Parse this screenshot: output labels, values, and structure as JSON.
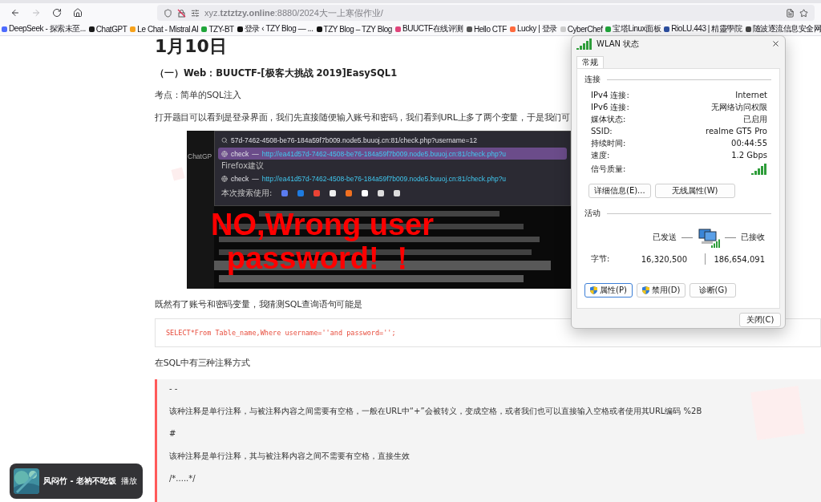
{
  "browser": {
    "nav_buttons": [
      {
        "kind": "back",
        "disabled": false
      },
      {
        "kind": "forward",
        "disabled": true
      },
      {
        "kind": "reload",
        "disabled": false
      },
      {
        "kind": "home",
        "disabled": false
      }
    ],
    "url": "xyz.**tztztzy.online**:8880/2024大一上寒假作业/",
    "bookmarks": [
      {
        "label": "DeepSeek - 探索未至...",
        "color": "#4d6bfe"
      },
      {
        "label": "ChatGPT",
        "color": "#1a1a1a"
      },
      {
        "label": "Le Chat - Mistral AI",
        "color": "#f7a21b"
      },
      {
        "label": "TZY-BT",
        "color": "#20a53a"
      },
      {
        "label": "登录 ‹ TZY Blog — ...",
        "color": "#111111"
      },
      {
        "label": "TZY Blog – TZY Blog",
        "color": "#111111"
      },
      {
        "label": "BUUCTF在线评测",
        "color": "#e0457b"
      },
      {
        "label": "Hello CTF",
        "color": "#555555"
      },
      {
        "label": "Lucky | 登录",
        "color": "#ff6a3d"
      },
      {
        "label": "CyberChef",
        "color": "#cccccc"
      },
      {
        "label": "宝塔Linux面板",
        "color": "#20a53a"
      },
      {
        "label": "RioLU.443 | 精靈學院",
        "color": "#2d4fa0"
      },
      {
        "label": "随波逐流信息安全网",
        "color": "#444444"
      }
    ]
  },
  "article": {
    "blocks": [
      {
        "kind": "title",
        "text": "1月10日"
      },
      {
        "kind": "heading",
        "text": "（一）Web：BUUCTF-[极客大挑战 2019]EasySQL1"
      },
      {
        "kind": "paragraph",
        "text": "考点：简单的SQL注入"
      },
      {
        "kind": "paragraph",
        "text": "打开题目可以看到是登录界面，我们先直接随便输入账号和密码，我们看到URL上多了两个变量，于是我们可"
      },
      {
        "kind": "screenshot",
        "side_label": "ChatGP",
        "search_text": "57d-7462-4508-be76-184a59f7b009.node5.buuoj.cn:81/check.php?username=12",
        "items": [
          {
            "kind": "row",
            "title": "check",
            "separator": "—",
            "url": "http://ea41d57d-7462-4508-be76-184a59f7b009.node5.buuoj.cn:81/check.php?u",
            "selected": true
          },
          {
            "kind": "label",
            "text": "Firefox建议"
          },
          {
            "kind": "row",
            "title": "check",
            "separator": "—",
            "url": "http://ea41d57d-7462-4508-be76-184a59f7b009.node5.buuoj.cn:81/check.php?u",
            "selected": false
          }
        ],
        "engines_label": "本次搜索使用:",
        "overlay_lines": [
          "NO,Wrong user",
          "password! ！"
        ]
      },
      {
        "kind": "paragraph",
        "text": "既然有了账号和密码变量，我猜测SQL查询语句可能是"
      },
      {
        "kind": "code",
        "text": "SELECT*From Table_name,Where username=''and password='';"
      },
      {
        "kind": "paragraph",
        "text": "在SQL中有三种注释方式"
      },
      {
        "kind": "quote",
        "lines": [
          "- -",
          "该种注释是单行注释，与被注释内容之间需要有空格，一般在URL中“+”会被转义，变成空格，或者我们也可以直接输入空格或者使用其URL编码 %2B",
          "#",
          "该种注释是单行注释，其与被注释内容之间不需要有空格，直接生效",
          "/*.....*/"
        ]
      }
    ]
  },
  "dialog": {
    "title": "WLAN 状态",
    "tabs": [
      {
        "label": "常规",
        "selected": true
      }
    ],
    "connection_heading": "连接",
    "rows": [
      {
        "kind": "text",
        "label": "IPv4 连接:",
        "value": "Internet"
      },
      {
        "kind": "text",
        "label": "IPv6 连接:",
        "value": "无网络访问权限"
      },
      {
        "kind": "text",
        "label": "媒体状态:",
        "value": "已启用"
      },
      {
        "kind": "text",
        "label": "SSID:",
        "value": "realme GT5 Pro"
      },
      {
        "kind": "text",
        "label": "持续时间:",
        "value": "00:44:55"
      },
      {
        "kind": "text",
        "label": "速度:",
        "value": "1.2 Gbps"
      },
      {
        "kind": "signal",
        "label": "信号质量:"
      }
    ],
    "detail_buttons": [
      "详细信息(E)...",
      "无线属性(W)"
    ],
    "activity_heading": "活动",
    "sent_label": "已发送",
    "received_label": "已接收",
    "bytes_label": "字节:",
    "sent_bytes": "16,320,500",
    "received_bytes": "186,654,091",
    "action_buttons": [
      {
        "label": "属性(P)",
        "shield": true,
        "selected": true
      },
      {
        "label": "禁用(D)",
        "shield": true,
        "selected": false
      },
      {
        "label": "诊断(G)",
        "shield": false,
        "selected": false
      }
    ],
    "close_button": "关闭(C)"
  },
  "player": {
    "title": "风闷竹 - 老衲不吃饭",
    "button": "播放"
  }
}
